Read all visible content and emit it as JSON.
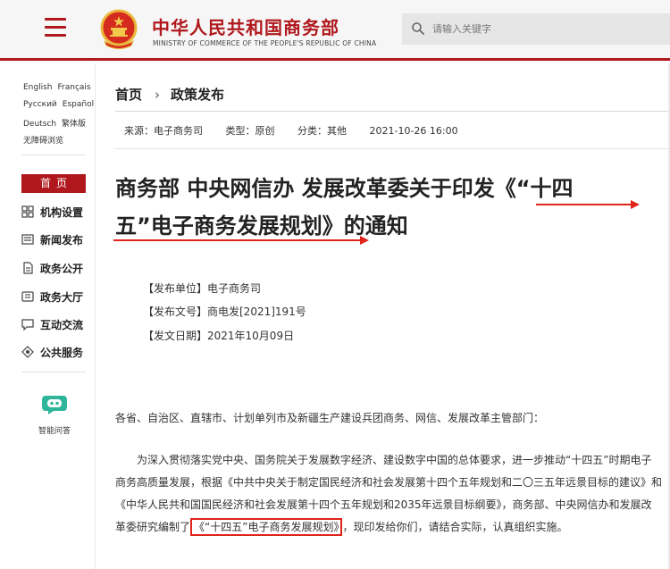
{
  "header": {
    "site_name_cn": "中华人民共和国商务部",
    "site_name_en": "MINISTRY OF COMMERCE OF THE PEOPLE'S REPUBLIC OF CHINA",
    "search_placeholder": "请输入关键字",
    "accent_color": "#b0181d"
  },
  "sidebar": {
    "languages_row1": [
      "English",
      "Français"
    ],
    "languages_row2": [
      "Русский",
      "Español"
    ],
    "languages_row3": [
      "Deutsch",
      "繁体版"
    ],
    "accessibility": "无障碍浏览",
    "home": "首页",
    "nav": [
      {
        "label": "机构设置",
        "icon": "org-grid-icon"
      },
      {
        "label": "新闻发布",
        "icon": "news-icon"
      },
      {
        "label": "政务公开",
        "icon": "document-icon"
      },
      {
        "label": "政务大厅",
        "icon": "hall-icon"
      },
      {
        "label": "互动交流",
        "icon": "chat-icon"
      },
      {
        "label": "公共服务",
        "icon": "service-icon"
      }
    ],
    "assistant": "智能问答"
  },
  "breadcrumb": {
    "home": "首页",
    "section": "政策发布"
  },
  "meta": {
    "source": "来源：电子商务司",
    "type": "类型：原创",
    "category": "分类：其他",
    "date": "2021-10-26 16:00"
  },
  "article": {
    "title_line1": "商务部 中央网信办 发展改革委关于印发《“十四",
    "title_line2": "五”电子商务发展规划》的通知",
    "issuer": "【发布单位】电子商务司",
    "doc_no": "【发布文号】商电发[2021]191号",
    "issue_date": "【发文日期】2021年10月09日",
    "salutation": "各省、自治区、直辖市、计划单列市及新疆生产建设兵团商务、网信、发展改革主管部门：",
    "para_before": "为深入贯彻落实党中央、国务院关于发展数字经济、建设数字中国的总体要求，进一步推动“十四五”时期电子商务高质量发展，根据《中共中央关于制定国民经济和社会发展第十四个五年规划和二〇三五年远景目标的建议》和《中华人民共和国国民经济和社会发展第十四个五年规划和2035年远景目标纲要》，商务部、中央网信办和发展改革委研究编制了",
    "para_highlight": "《“十四五”电子商务发展规划》",
    "para_after": "，现印发给你们，请结合实际，认真组织实施。"
  }
}
